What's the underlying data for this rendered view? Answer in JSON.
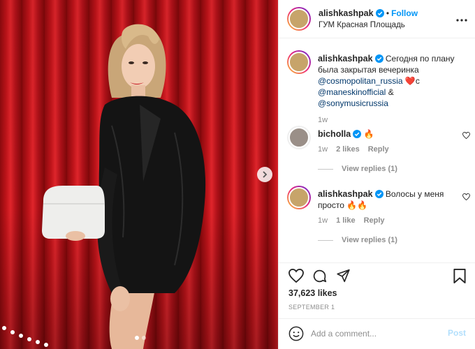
{
  "post": {
    "username": "alishkashpak",
    "follow_label": "Follow",
    "location": "ГУМ Красная Площадь",
    "image_alt": "photo",
    "carousel_total": 2,
    "carousel_active": 1
  },
  "caption": {
    "username": "alishkashpak",
    "text_line1": "Сегодня по плану",
    "text_line2": "была закрытая вечеринка",
    "mention1": "@cosmopolitan_russia",
    "heart": "❤️",
    "conj1": "с",
    "mention2": "@maneskinofficial",
    "conj2": "&",
    "mention3": "@sonymusicrussia",
    "time": "1w"
  },
  "comments": [
    {
      "username": "bicholla",
      "text": "🔥",
      "time": "1w",
      "likes": "2 likes",
      "reply_label": "Reply",
      "view_replies": "View replies (1)"
    },
    {
      "username": "alishkashpak",
      "text_line1": "Волосы у меня",
      "text_line2": "просто 🔥🔥",
      "time": "1w",
      "likes": "1 like",
      "reply_label": "Reply",
      "view_replies": "View replies (1)"
    }
  ],
  "actions": {
    "likes": "37,623 likes",
    "date": "SEPTEMBER 1",
    "icons": [
      "heart-icon",
      "comment-icon",
      "share-icon",
      "bookmark-icon"
    ]
  },
  "add_comment": {
    "placeholder": "Add a comment...",
    "post_label": "Post"
  },
  "colors": {
    "accent": "#0095f6",
    "post_disabled": "#b2dffc",
    "mention": "#00376b",
    "muted": "#8e8e8e"
  }
}
